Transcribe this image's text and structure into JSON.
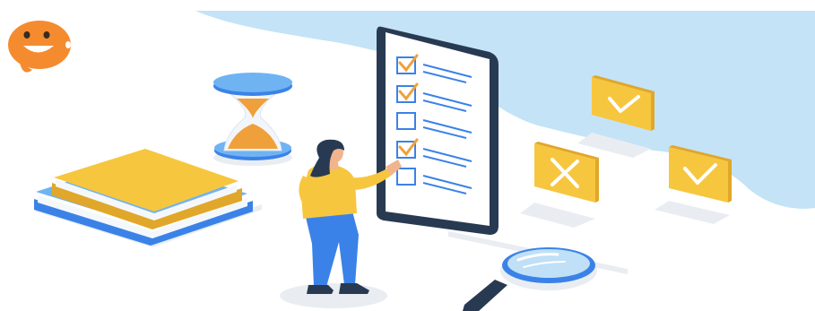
{
  "illustration": {
    "subject": "quiz-checklist-illustration",
    "icons": [
      "mascot-icon",
      "hourglass-icon",
      "books-icon",
      "checklist-board-icon",
      "checkbox-icon",
      "check-card-icon",
      "cross-card-icon",
      "magnifier-icon",
      "person-icon"
    ],
    "checklist": {
      "items": [
        {
          "checked": true
        },
        {
          "checked": true
        },
        {
          "checked": false
        },
        {
          "checked": true
        },
        {
          "checked": false
        }
      ]
    },
    "cards": [
      {
        "mark": "check"
      },
      {
        "mark": "cross"
      },
      {
        "mark": "check"
      }
    ]
  },
  "colors": {
    "sky_blob": "#c4e3f6",
    "yellow": "#f7c63f",
    "yellow_dark": "#e0a72a",
    "orange": "#f0a03a",
    "blue": "#3b82e8",
    "blue_light": "#6fb3f2",
    "navy": "#283a52",
    "mascot": "#f58b2f",
    "skin": "#f2b48c",
    "shadow": "#e9edf2"
  }
}
